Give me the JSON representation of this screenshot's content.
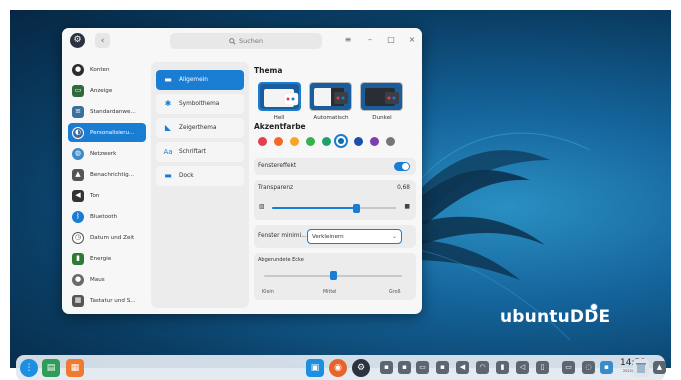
{
  "window": {
    "search_placeholder": "Suchen",
    "controls": {
      "menu": "≡",
      "minimize": "–",
      "maximize": "□",
      "close": "×"
    }
  },
  "sidebar": {
    "items": [
      {
        "label": "Konten",
        "icon": "user-icon",
        "color": "#2d2d2d"
      },
      {
        "label": "Anzeige",
        "icon": "monitor-icon",
        "color": "#2e6a3a"
      },
      {
        "label": "Standardanwe...",
        "icon": "default-apps-icon",
        "color": "#3c6f9e"
      },
      {
        "label": "Personalisieru...",
        "icon": "personalization-icon",
        "color": "#3b6aa0",
        "active": true
      },
      {
        "label": "Netzwerk",
        "icon": "network-icon",
        "color": "#3a8bc9"
      },
      {
        "label": "Benachrichtig...",
        "icon": "notification-icon",
        "color": "#555555"
      },
      {
        "label": "Ton",
        "icon": "sound-icon",
        "color": "#333333"
      },
      {
        "label": "Bluetooth",
        "icon": "bluetooth-icon",
        "color": "#1a7dd4"
      },
      {
        "label": "Datum und Zeit",
        "icon": "clock-icon",
        "color": "#ffffff"
      },
      {
        "label": "Energie",
        "icon": "battery-icon",
        "color": "#2f7a35"
      },
      {
        "label": "Maus",
        "icon": "mouse-icon",
        "color": "#6a6a6a"
      },
      {
        "label": "Tastatur und S...",
        "icon": "keyboard-icon",
        "color": "#555555"
      }
    ]
  },
  "submenu": {
    "items": [
      {
        "label": "Allgemein",
        "icon": "window-icon",
        "active": true
      },
      {
        "label": "Symbolthema",
        "icon": "icon-theme-icon"
      },
      {
        "label": "Zeigerthema",
        "icon": "cursor-icon"
      },
      {
        "label": "Schriftart",
        "icon": "font-icon"
      },
      {
        "label": "Dock",
        "icon": "dock-icon"
      }
    ]
  },
  "content": {
    "theme_title": "Thema",
    "themes": [
      {
        "label": "Hell",
        "selected": true
      },
      {
        "label": "Automatisch"
      },
      {
        "label": "Dunkel"
      }
    ],
    "accent_title": "Akzentfarbe",
    "accent_colors": [
      "#e53e4f",
      "#f26a23",
      "#f5a623",
      "#37b24d",
      "#22a06b",
      "#0f6ea8",
      "#1e4fa8",
      "#7b3fb0",
      "#777777"
    ],
    "accent_selected_index": 5,
    "window_effect_label": "Fenstereffekt",
    "window_effect_on": true,
    "transparency_label": "Transparenz",
    "transparency_value": "0,68",
    "transparency_fraction": 0.68,
    "minimize_label": "Fenster minimi...",
    "minimize_value": "Verkleinern",
    "rounded_label": "Abgerundete Ecke",
    "rounded_ticks": [
      "Klein",
      "Mittel",
      "Groß"
    ],
    "rounded_index": 1
  },
  "brand": "ubuntuDDE",
  "dock": {
    "time": "14:59",
    "date": "2022/04/25"
  }
}
